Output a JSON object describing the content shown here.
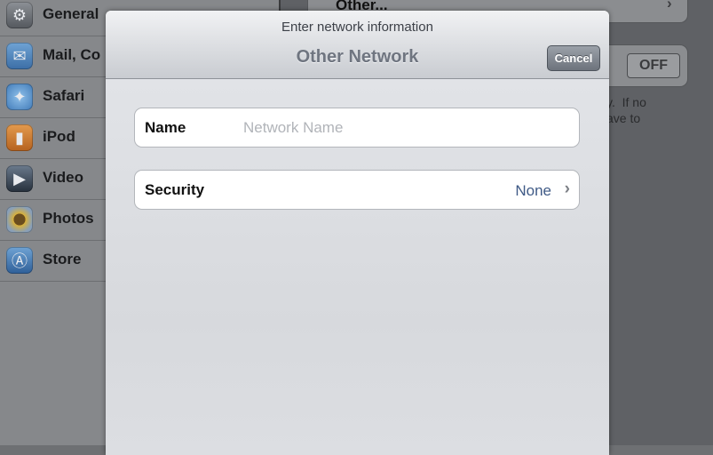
{
  "sidebar": {
    "items": [
      {
        "label": "General",
        "icon": "gear-icon"
      },
      {
        "label": "Mail, Co",
        "icon": "mail-icon"
      },
      {
        "label": "Safari",
        "icon": "safari-compass-icon"
      },
      {
        "label": "iPod",
        "icon": "ipod-icon"
      },
      {
        "label": "Video",
        "icon": "video-clapper-icon"
      },
      {
        "label": "Photos",
        "icon": "photos-sunflower-icon"
      },
      {
        "label": "Store",
        "icon": "app-store-icon"
      }
    ]
  },
  "background_detail": {
    "other_label": "Other...",
    "switch_label": "OFF",
    "hint_text": "y.  If no\nave to"
  },
  "modal": {
    "prompt": "Enter network information",
    "title": "Other Network",
    "cancel_label": "Cancel",
    "name_label": "Name",
    "name_value": "",
    "name_placeholder": "Network Name",
    "security_label": "Security",
    "security_value": "None"
  },
  "colors": {
    "nav_title": "#6f7580",
    "security_value": "#3f5a86",
    "cancel_button": "#7d838b"
  }
}
